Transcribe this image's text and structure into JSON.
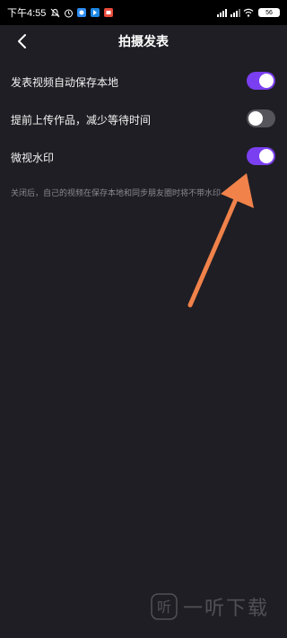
{
  "status_bar": {
    "time": "下午4:55",
    "icons_left": [
      "mute-icon",
      "alarm-icon",
      "app-icon-1",
      "app-icon-2",
      "app-icon-3"
    ],
    "icons_right": [
      "signal-icon",
      "signal-icon",
      "wifi-icon"
    ],
    "battery": "56"
  },
  "header": {
    "title": "拍摄发表",
    "back_icon": "chevron-left-icon"
  },
  "settings": {
    "items": [
      {
        "label": "发表视频自动保存本地",
        "enabled": true
      },
      {
        "label": "提前上传作品，减少等待时间",
        "enabled": false
      },
      {
        "label": "微视水印",
        "enabled": true
      }
    ],
    "hint": "关闭后，自己的视频在保存本地和同步朋友圈时将不带水印"
  },
  "colors": {
    "background": "#1f1e24",
    "toggle_on": "#7a3ff0",
    "toggle_off": "#55555b",
    "annotation_arrow": "#f0824a"
  },
  "watermark": {
    "logo_char": "听",
    "text": "一听下载"
  }
}
